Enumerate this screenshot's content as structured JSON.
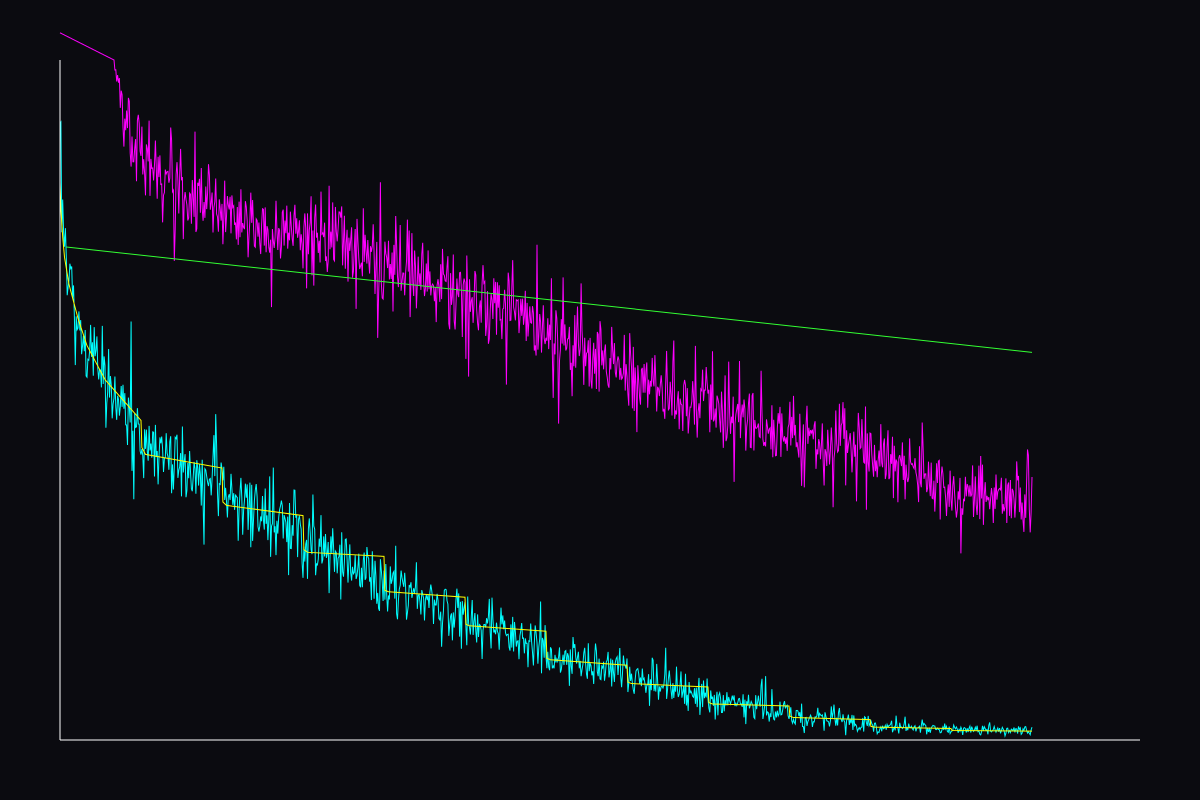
{
  "chart_data": {
    "type": "line",
    "title": "",
    "xlabel": "",
    "ylabel": "",
    "grid": false,
    "legend": "none",
    "x_range": [
      0,
      1200
    ],
    "y_range": [
      0,
      1
    ],
    "noise_seed": 12345,
    "samples_per_series": 1080,
    "background_color": "#0b0b10",
    "axis_color": "#ffffff",
    "series": [
      {
        "color": "#ff00ff",
        "style": "noisy",
        "x": [
          0,
          60,
          70,
          80,
          90,
          100,
          120,
          200,
          300,
          400,
          500,
          600,
          700,
          800,
          900,
          1000,
          1080
        ],
        "y_mean": [
          1.04,
          1.0,
          0.93,
          0.88,
          0.87,
          0.86,
          0.82,
          0.77,
          0.73,
          0.68,
          0.63,
          0.56,
          0.5,
          0.45,
          0.42,
          0.36,
          0.35
        ],
        "y_noise": [
          0,
          0,
          0.05,
          0.05,
          0.05,
          0.05,
          0.05,
          0.05,
          0.055,
          0.055,
          0.055,
          0.055,
          0.05,
          0.05,
          0.05,
          0.045,
          0.045
        ]
      },
      {
        "color": "#00ffff",
        "style": "noisy",
        "x": [
          0,
          2,
          5,
          10,
          20,
          40,
          60,
          90,
          91,
          180,
          181,
          270,
          271,
          360,
          361,
          450,
          451,
          540,
          541,
          630,
          631,
          720,
          721,
          810,
          811,
          900,
          901,
          990,
          991,
          1080
        ],
        "y_mean": [
          0.9,
          0.78,
          0.72,
          0.68,
          0.62,
          0.55,
          0.51,
          0.46,
          0.43,
          0.38,
          0.36,
          0.31,
          0.29,
          0.24,
          0.23,
          0.19,
          0.17,
          0.14,
          0.12,
          0.1,
          0.09,
          0.065,
          0.06,
          0.042,
          0.035,
          0.025,
          0.02,
          0.017,
          0.016,
          0.014
        ],
        "y_noise": [
          0.06,
          0.06,
          0.06,
          0.06,
          0.06,
          0.06,
          0.06,
          0.06,
          0.05,
          0.05,
          0.05,
          0.05,
          0.045,
          0.045,
          0.04,
          0.04,
          0.035,
          0.035,
          0.03,
          0.03,
          0.025,
          0.025,
          0.02,
          0.02,
          0.015,
          0.012,
          0.01,
          0.008,
          0.007,
          0.006
        ]
      },
      {
        "color": "#ffff00",
        "style": "line",
        "x": [
          0,
          1,
          3,
          5,
          10,
          20,
          30,
          50,
          70,
          90,
          91,
          95,
          180,
          181,
          185,
          270,
          271,
          275,
          360,
          361,
          365,
          450,
          451,
          455,
          540,
          541,
          545,
          630,
          631,
          635,
          720,
          721,
          725,
          810,
          811,
          815,
          900,
          901,
          905,
          990,
          991,
          1080
        ],
        "y": [
          0.82,
          0.78,
          0.74,
          0.71,
          0.67,
          0.62,
          0.58,
          0.53,
          0.5,
          0.47,
          0.43,
          0.42,
          0.4,
          0.35,
          0.345,
          0.33,
          0.28,
          0.276,
          0.27,
          0.22,
          0.218,
          0.21,
          0.17,
          0.168,
          0.16,
          0.12,
          0.118,
          0.11,
          0.085,
          0.083,
          0.078,
          0.055,
          0.053,
          0.05,
          0.035,
          0.033,
          0.03,
          0.02,
          0.019,
          0.017,
          0.014,
          0.013
        ]
      },
      {
        "color": "#33ff33",
        "style": "line",
        "x": [
          7,
          1080
        ],
        "y": [
          0.725,
          0.57
        ]
      }
    ]
  }
}
